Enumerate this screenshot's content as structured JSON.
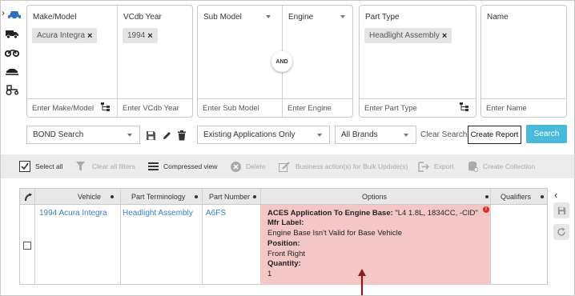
{
  "filters": {
    "make_model": {
      "label": "Make/Model",
      "chip": "Acura Integra",
      "placeholder": "Enter Make/Model"
    },
    "vcdb_year": {
      "label": "VCdb Year",
      "chip": "1994",
      "placeholder": "Enter VCdb Year"
    },
    "sub_model": {
      "label": "Sub Model",
      "placeholder": "Enter Sub Model"
    },
    "engine": {
      "label": "Engine",
      "placeholder": "Enter Engine"
    },
    "and_label": "AND",
    "part_type": {
      "label": "Part Type",
      "chip": "Headlight Assembly",
      "placeholder": "Enter Part Type"
    },
    "name": {
      "label": "Name",
      "placeholder": "Enter Name"
    },
    "chip_remove": "×"
  },
  "controls": {
    "bond_search": "BOND Search",
    "applications_filter": "Existing Applications Only",
    "brands": "All Brands",
    "clear_search": "Clear Search",
    "create_report": "Create Report",
    "search": "Search"
  },
  "toolbar": {
    "select_all": "Select all",
    "clear_filters": "Clear all filters",
    "compressed_view": "Compressed view",
    "delete": "Delete",
    "business_action": "Business action(s) for Bulk Update(s)",
    "export": "Export",
    "create_collection": "Create Collection"
  },
  "table": {
    "columns": [
      "Vehicle",
      "Part Terminology",
      "Part Number",
      "Options",
      "Qualifiers"
    ],
    "row": {
      "vehicle": "1994 Acura Integra",
      "part_terminology": "Headlight Assembly",
      "part_number": "A6FS",
      "options": {
        "aces_label": "ACES Application To Engine Base:",
        "aces_value": " \"L4 1.8L, 1834CC, -CID\"",
        "mfr_label": "Mfr Label:",
        "mfr_value": "Engine Base Isn't Valid for Base Vehicle",
        "position_label": "Position:",
        "position_value": "Front Right",
        "quantity_label": "Quantity:",
        "quantity_value": "1",
        "error_badge": "!"
      }
    }
  },
  "colors": {
    "accent": "#48b9d9",
    "link": "#3a7fc2",
    "error_bg": "#f4c7c7",
    "error_badge": "#d93025",
    "annotation_arrow": "#8b1a1a"
  },
  "icons": {
    "rail": [
      "car-icon",
      "truck-icon",
      "motorcycle-icon",
      "snowmobile-icon",
      "tractor-icon"
    ],
    "controls": [
      "save-icon",
      "edit-icon",
      "trash-icon"
    ],
    "toolbar": [
      "select-all-icon",
      "filter-clear-icon",
      "compressed-view-icon",
      "delete-icon",
      "business-action-icon",
      "export-icon",
      "collection-icon"
    ],
    "side": [
      "chevron-left-icon",
      "save-icon",
      "refresh-icon"
    ]
  }
}
